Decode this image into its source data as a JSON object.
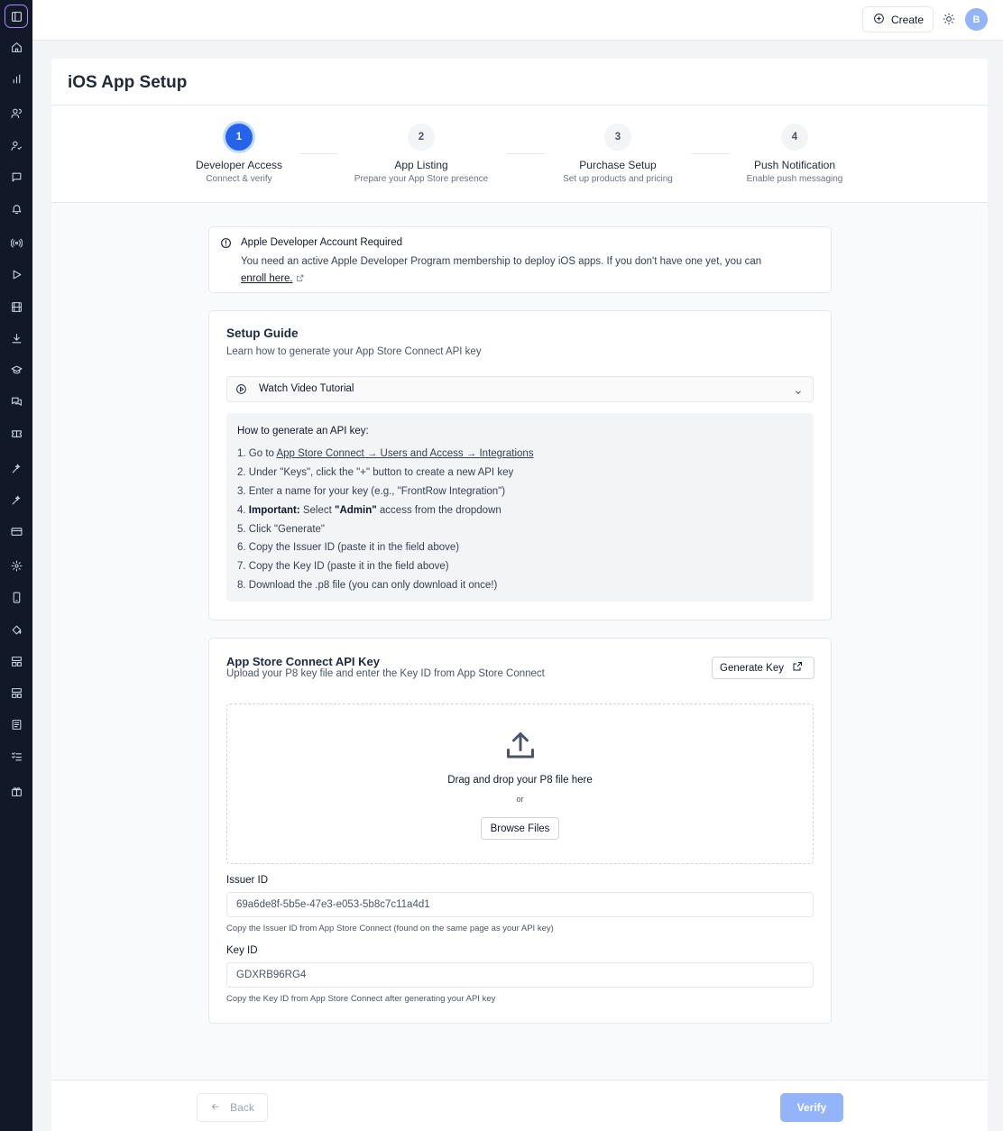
{
  "sidebar": {
    "icons": [
      "panel-toggle-icon",
      "home-icon",
      "chart-icon",
      "users-icon",
      "user-check-icon",
      "message-icon",
      "bell-icon",
      "broadcast-icon",
      "play-icon",
      "film-icon",
      "download-icon",
      "graduation-cap-icon",
      "chat-bubbles-icon",
      "ticket-icon",
      "sparkles-icon",
      "sparkles-alt-icon",
      "credit-card-icon",
      "settings-icon",
      "smartphone-icon",
      "paint-bucket-icon",
      "layout-icon",
      "layout-alt-icon",
      "document-icon",
      "list-checks-icon",
      "gift-icon"
    ]
  },
  "topbar": {
    "create_label": "Create",
    "avatar_initial": "B",
    "accent_color": "#93b4f8"
  },
  "page": {
    "title": "iOS App Setup"
  },
  "stepper": {
    "current_step": 1,
    "steps": [
      {
        "number": "1",
        "label": "Developer Access",
        "desc": "Connect & verify"
      },
      {
        "number": "2",
        "label": "App Listing",
        "desc": "Prepare your App Store presence"
      },
      {
        "number": "3",
        "label": "Purchase Setup",
        "desc": "Set up products and pricing"
      },
      {
        "number": "4",
        "label": "Push Notification",
        "desc": "Enable push messaging"
      }
    ]
  },
  "alert": {
    "title": "Apple Developer Account Required",
    "text": "You need an active Apple Developer Program membership to deploy iOS apps. If you don't have one yet, you can",
    "link": "enroll here."
  },
  "guide": {
    "title": "Setup Guide",
    "subtitle": "Learn how to generate your App Store Connect API key",
    "video_label": "Watch Video Tutorial",
    "heading": "How to generate an API key:",
    "steps": {
      "s1_prefix": "1. Go to ",
      "s1_link": "App Store Connect → Users and Access → Integrations",
      "s2": "2. Under \"Keys\", click the \"+\" button to create a new API key",
      "s3": "3. Enter a name for your key (e.g., \"FrontRow Integration\")",
      "s4_prefix": "4. ",
      "s4_bold": "Important:",
      "s4_mid": " Select ",
      "s4_bold2": "\"Admin\"",
      "s4_suffix": " access from the dropdown",
      "s5": "5. Click \"Generate\"",
      "s6": "6. Copy the Issuer ID (paste it in the field above)",
      "s7": "7. Copy the Key ID (paste it in the field above)",
      "s8": "8. Download the .p8 file (you can only download it once!)"
    }
  },
  "api": {
    "title": "App Store Connect API Key",
    "subtitle": "Upload your P8 key file and enter the Key ID from App Store Connect",
    "generate_label": "Generate Key",
    "dropzone_text": "Drag and drop your P8 file here",
    "dropzone_or": "or",
    "browse_label": "Browse Files",
    "issuer_label": "Issuer ID",
    "issuer_value": "69a6de8f-5b5e-47e3-e053-5b8c7c11a4d1",
    "issuer_help": "Copy the Issuer ID from App Store Connect (found on the same page as your API key)",
    "key_label": "Key ID",
    "key_value": "GDXRB96RG4",
    "key_help": "Copy the Key ID from App Store Connect after generating your API key"
  },
  "footer": {
    "back_label": "Back",
    "verify_label": "Verify",
    "primary_color": "#2563eb"
  }
}
